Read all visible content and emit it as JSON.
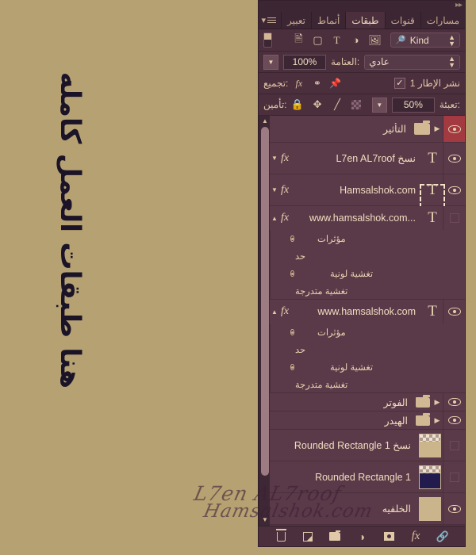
{
  "canvas": {
    "vertical_note": "هنا طبقات العمل كامله",
    "watermark_line1": "L7en AL7roof",
    "watermark_line2": "Hamsalshok.com",
    "background_color": "#b5a171"
  },
  "panel": {
    "tabs": [
      {
        "label": "تعبير",
        "active": false
      },
      {
        "label": "أنماط",
        "active": false
      },
      {
        "label": "طبقات",
        "active": true
      },
      {
        "label": "قنوات",
        "active": false
      },
      {
        "label": "مسارات",
        "active": false
      }
    ],
    "filter_row": {
      "kind_label": "Kind",
      "search_icon": "magnifier-icon",
      "icons": [
        "image-icon",
        "adjustment-icon",
        "type-icon",
        "shape-icon",
        "smart-object-icon"
      ],
      "toggle_name": "filter-toggle"
    },
    "blend_row": {
      "blend_mode": "عادي",
      "opacity_label": ":العتامة",
      "opacity_value": "100%"
    },
    "prop_row": {
      "propagate_label": "نشر الإطار 1",
      "checked": true,
      "group_label": ":تجميع",
      "icons": [
        "pin-icon",
        "link-ellipse-icon",
        "fx-icon"
      ]
    },
    "lock_row": {
      "lock_label": ":تأمين",
      "fill_label": ":تعبئة",
      "fill_value": "50%",
      "icons": [
        "transparency-lock-icon",
        "brush-lock-icon",
        "move-lock-icon",
        "lock-all-icon"
      ]
    },
    "layers": [
      {
        "name": "التأثير",
        "type": "group",
        "visible": true,
        "selected": true,
        "has_fx": false,
        "expanded": false
      },
      {
        "name": "نسخ L7en AL7roof",
        "type": "text",
        "visible": true,
        "selected": false,
        "has_fx": true,
        "fx_expanded": false
      },
      {
        "name": "Hamsalshok.com",
        "type": "text",
        "visible": true,
        "selected": false,
        "has_fx": true,
        "fx_expanded": false,
        "editing": true
      },
      {
        "name": "www.hamsalshok.com...",
        "type": "text",
        "visible": false,
        "selected": false,
        "has_fx": true,
        "fx_expanded": true,
        "effects": [
          "مؤثرات",
          "حد",
          "تغشية لونية",
          "تغشية متدرجة"
        ]
      },
      {
        "name": "www.hamsalshok.com",
        "type": "text",
        "visible": true,
        "selected": false,
        "has_fx": true,
        "fx_expanded": true,
        "effects": [
          "مؤثرات",
          "حد",
          "تغشية لونية",
          "تغشية متدرجة"
        ]
      },
      {
        "name": "الفوتر",
        "type": "group",
        "visible": true,
        "selected": false,
        "has_fx": false,
        "expanded": false
      },
      {
        "name": "الهيدر",
        "type": "group",
        "visible": true,
        "selected": false,
        "has_fx": false,
        "expanded": false
      },
      {
        "name": "نسخ Rounded Rectangle 1",
        "type": "shape",
        "visible": false,
        "selected": false,
        "has_fx": false,
        "thumb_color": "#cbb68c"
      },
      {
        "name": "Rounded Rectangle 1",
        "type": "shape",
        "visible": false,
        "selected": false,
        "has_fx": false,
        "thumb_color": "#221c4e"
      },
      {
        "name": "الخلفيه",
        "type": "shape",
        "visible": true,
        "selected": false,
        "has_fx": false,
        "thumb_color": "#c9b48c"
      }
    ],
    "footer_buttons": [
      "link-layers-icon",
      "layer-style-fx-icon",
      "layer-mask-icon",
      "adjustment-layer-icon",
      "new-group-icon",
      "new-layer-icon",
      "delete-layer-icon"
    ],
    "scrollbar": {
      "up_arrow": "▲",
      "down_arrow": "▼"
    },
    "colors": {
      "panel_bg": "#4b2f3d",
      "list_bg": "#5a3a48",
      "selected_row": "#a33a42",
      "text": "#f0dcc0"
    }
  }
}
